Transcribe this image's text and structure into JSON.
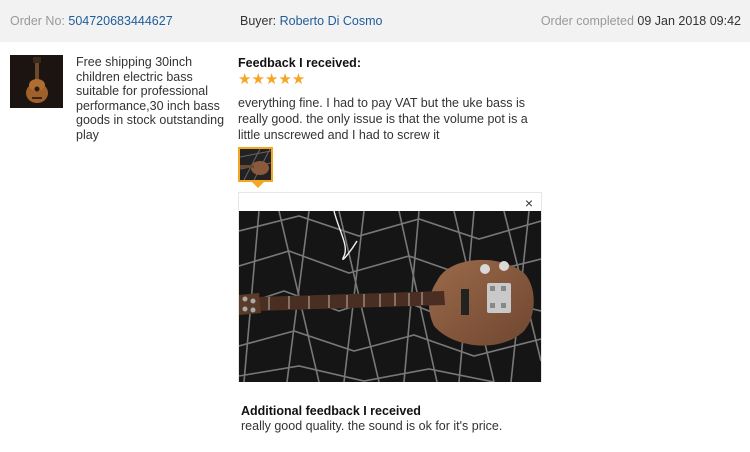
{
  "header": {
    "order_label": "Order No:",
    "order_number": "504720683444627",
    "buyer_label": "Buyer:",
    "buyer_name": "Roberto Di Cosmo",
    "completed_label": "Order completed",
    "completed_date": "09 Jan 2018 09:42"
  },
  "product": {
    "title": "Free shipping 30inch children electric bass suitable for professional performance,30 inch bass goods in stock outstanding play",
    "thumbnail_icon": "guitar-product-image"
  },
  "feedback": {
    "heading": "Feedback I received:",
    "stars": "★★★★★",
    "rating": 5,
    "rating_max": 5,
    "text": "everything fine. I had to pay VAT but the uke bass is really good. the only issue is that the volume pot is a little unscrewed and I had to screw it",
    "photo_thumb_icon": "buyer-photo-thumbnail",
    "viewer_close": "×"
  },
  "additional": {
    "heading": "Additional feedback I received",
    "text": "really good quality. the sound is ok for it's price."
  },
  "colors": {
    "header_bg": "#f2f2f2",
    "link": "#1f5c99",
    "star": "#f5a623"
  }
}
